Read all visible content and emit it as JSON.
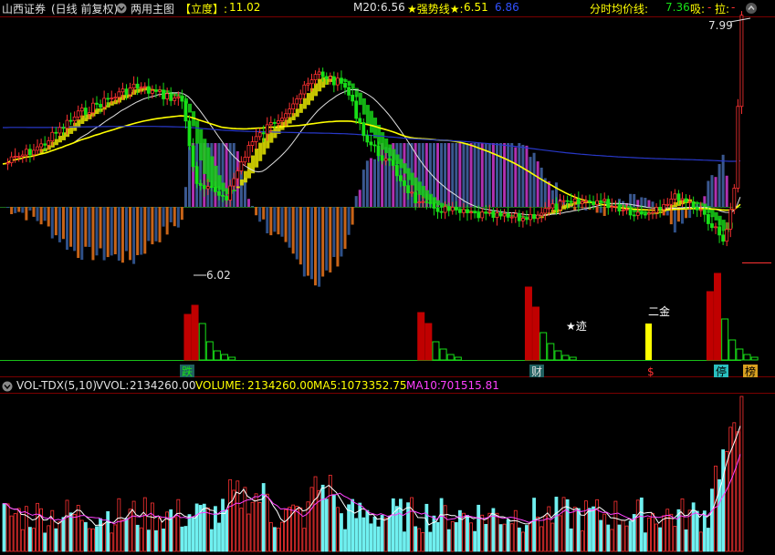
{
  "header": {
    "broker": "山西证券",
    "period": "(日线 前复权)",
    "formula": "两用主图",
    "lidu_label": "【立度】:",
    "lidu_value": "11.02",
    "m20_label": "M20:",
    "m20_value": "6.56",
    "strong_label": "★强势线★:",
    "strong_value": "6.51",
    "third_value": "6.86",
    "avg_label": "分时均价线:",
    "avg_value": "7.36",
    "xi_label": "吸:",
    "la_label": "拉:"
  },
  "annotations": {
    "high_price": "7.99",
    "low_price": "6.02",
    "star_trace": "★迹",
    "erjin": "二金",
    "die": "跌",
    "cai": "财",
    "dollar": "$",
    "ting": "停",
    "bang": "榜"
  },
  "volume_header": {
    "indicator": "VOL-TDX(5,10)",
    "vvol_label": "VVOL:",
    "vvol_value": "2134260.00",
    "volume_label": "VOLUME:",
    "volume_value": "2134260.00",
    "ma5_label": "MA5:",
    "ma5_value": "1073352.75",
    "ma10_label": "MA10:",
    "ma10_value": "701515.81"
  },
  "colors": {
    "up": "#ff3232",
    "down": "#00e8e8",
    "green": "#18e018",
    "yellow": "#ffff00",
    "magenta": "#b030b0",
    "orange": "#c86418",
    "blue": "#2850a0",
    "ma10": "#ff40ff"
  }
}
